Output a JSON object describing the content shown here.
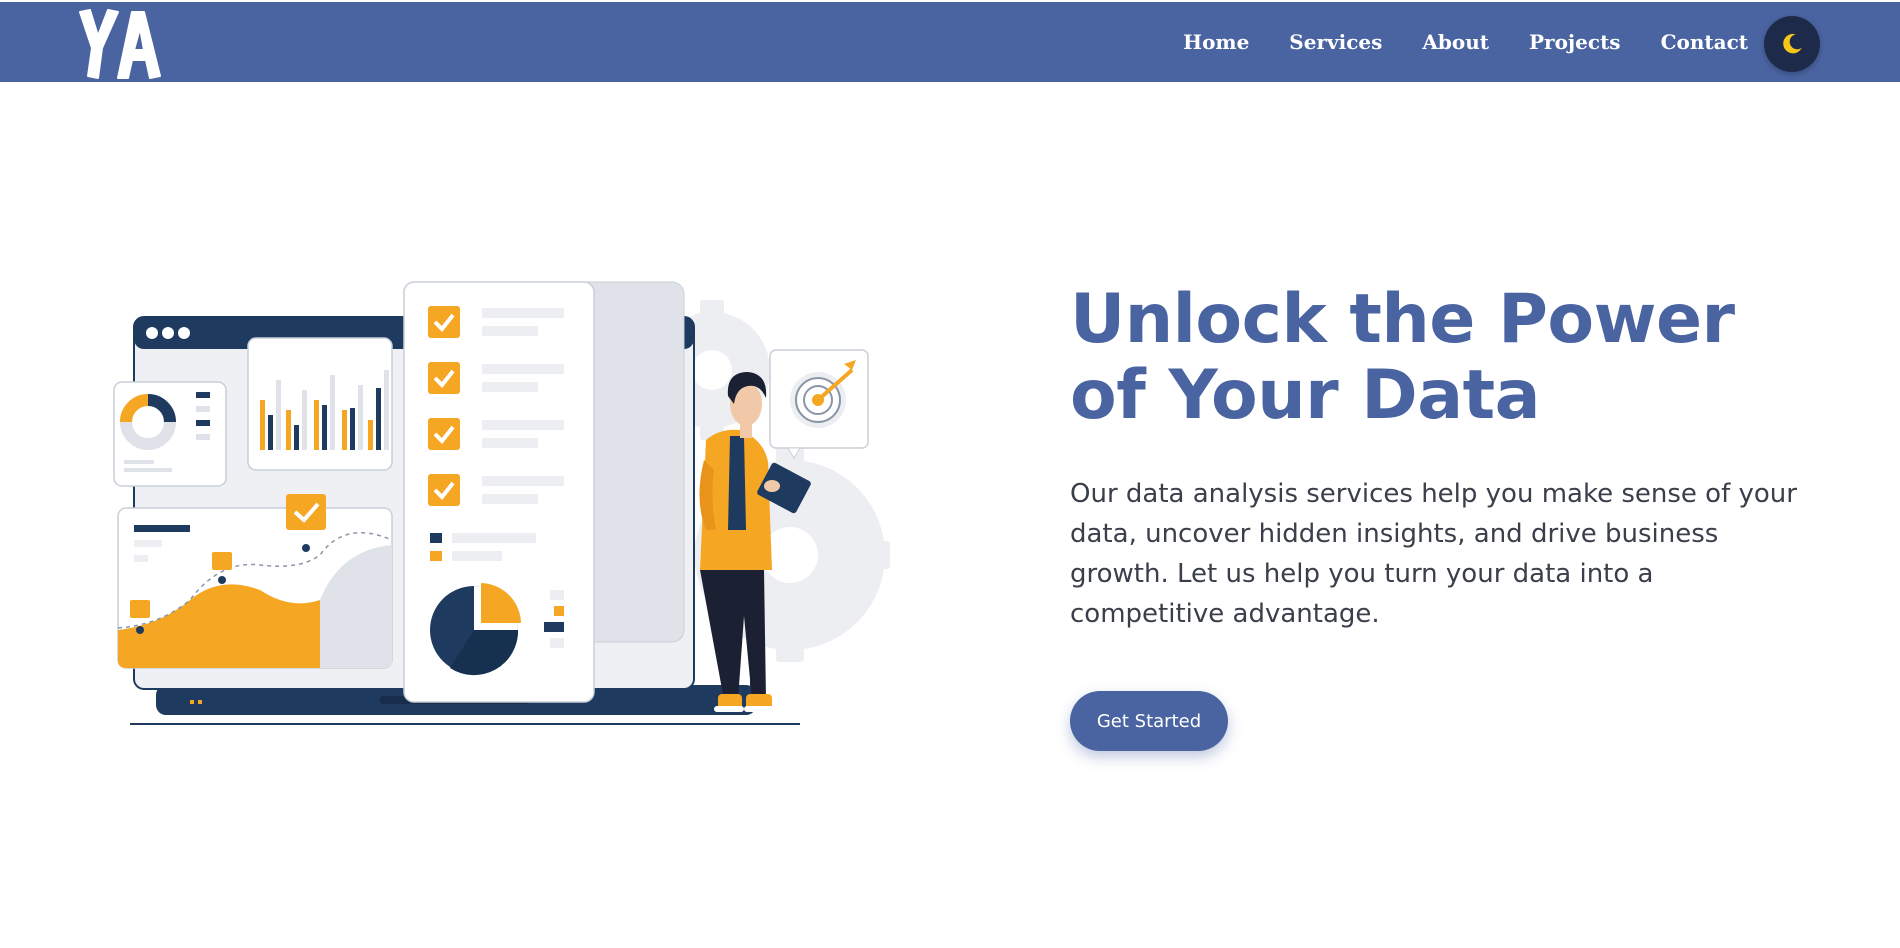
{
  "brand": {
    "logo_text": "YA"
  },
  "nav": {
    "items": [
      {
        "label": "Home"
      },
      {
        "label": "Services"
      },
      {
        "label": "About"
      },
      {
        "label": "Projects"
      },
      {
        "label": "Contact"
      }
    ],
    "theme_toggle_icon": "moon-icon"
  },
  "hero": {
    "title": "Unlock the Power of Your Data",
    "description": "Our data analysis services help you make sense of your data, uncover hidden insights, and drive business growth. Let us help you turn your data into a competitive advantage.",
    "cta_label": "Get Started"
  },
  "colors": {
    "primary": "#4a64a2",
    "accent": "#f5a623",
    "dark_navy": "#1e3a5f",
    "toggle_bg": "#1e2a4a"
  }
}
